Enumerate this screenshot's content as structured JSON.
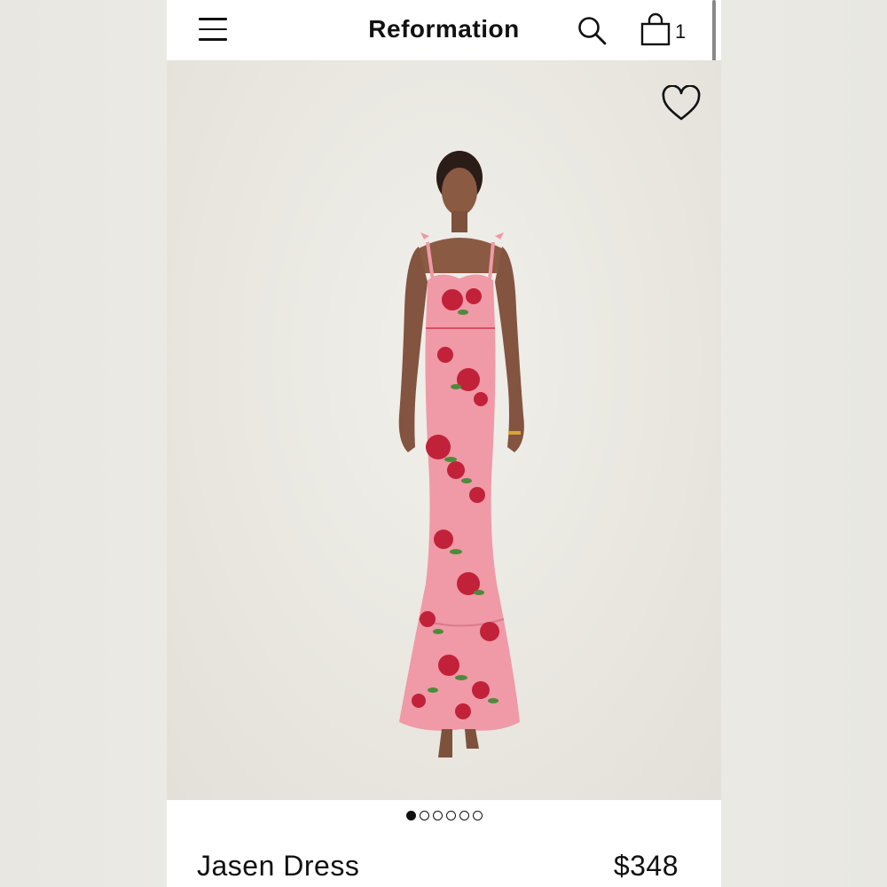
{
  "header": {
    "brand": "Reformation",
    "bag_count": "1"
  },
  "carousel": {
    "total_images": 6,
    "active_index": 0
  },
  "product": {
    "name": "Jasen Dress",
    "price": "$348"
  },
  "icons": [
    "menu-icon",
    "search-icon",
    "bag-icon",
    "heart-icon"
  ],
  "colors": {
    "dress_pink": "#ef9aa6",
    "floral_red": "#c2213a",
    "leaf_green": "#4f8a3c",
    "text": "#111111"
  }
}
